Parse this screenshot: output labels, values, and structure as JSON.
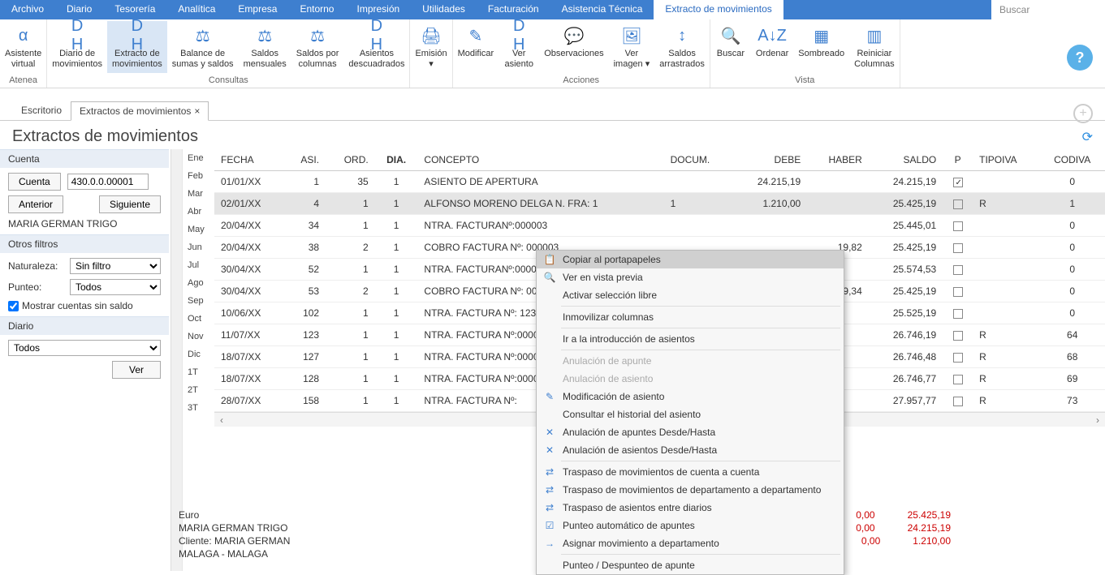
{
  "menubar": {
    "items": [
      "Archivo",
      "Diario",
      "Tesorería",
      "Analítica",
      "Empresa",
      "Entorno",
      "Impresión",
      "Utilidades",
      "Facturación",
      "Asistencia Técnica",
      "Extracto de movimientos"
    ],
    "active_index": 10,
    "search_placeholder": "Buscar"
  },
  "ribbon": {
    "groups": [
      {
        "label": "Atenea",
        "buttons": [
          {
            "label": "Asistente\nvirtual",
            "icon": "α"
          }
        ]
      },
      {
        "label": "Consultas",
        "buttons": [
          {
            "label": "Diario de\nmovimientos",
            "icon": "D H"
          },
          {
            "label": "Extracto de\nmovimientos",
            "icon": "D H",
            "active": true
          },
          {
            "label": "Balance de\nsumas y saldos",
            "icon": "⚖"
          },
          {
            "label": "Saldos\nmensuales",
            "icon": "⚖"
          },
          {
            "label": "Saldos por\ncolumnas",
            "icon": "⚖"
          },
          {
            "label": "Asientos\ndescuadrados",
            "icon": "D H"
          }
        ]
      },
      {
        "label": "",
        "buttons": [
          {
            "label": "Emisión\n▾",
            "icon": "🖨"
          }
        ]
      },
      {
        "label": "Acciones",
        "buttons": [
          {
            "label": "Modificar",
            "icon": "✎"
          },
          {
            "label": "Ver\nasiento",
            "icon": "D H"
          },
          {
            "label": "Observaciones",
            "icon": "💬"
          },
          {
            "label": "Ver\nimagen ▾",
            "icon": "🖼"
          },
          {
            "label": "Saldos\narrastrados",
            "icon": "↕"
          }
        ]
      },
      {
        "label": "Vista",
        "buttons": [
          {
            "label": "Buscar",
            "icon": "🔍"
          },
          {
            "label": "Ordenar",
            "icon": "A↓Z"
          },
          {
            "label": "Sombreado",
            "icon": "▦"
          },
          {
            "label": "Reiniciar\nColumnas",
            "icon": "▥"
          }
        ]
      }
    ]
  },
  "subtabs": {
    "items": [
      {
        "label": "Escritorio",
        "closable": false
      },
      {
        "label": "Extractos de movimientos",
        "closable": true,
        "active": true
      }
    ]
  },
  "page_title": "Extractos de movimientos",
  "sidebar": {
    "sections": {
      "cuenta": {
        "title": "Cuenta",
        "cuenta_btn": "Cuenta",
        "cuenta_val": "430.0.0.00001",
        "anterior": "Anterior",
        "siguiente": "Siguiente",
        "holder_name": "MARIA GERMAN TRIGO"
      },
      "otros": {
        "title": "Otros filtros",
        "naturaleza_label": "Naturaleza:",
        "naturaleza_val": "Sin filtro",
        "punteo_label": "Punteo:",
        "punteo_val": "Todos",
        "mostrar_label": "Mostrar cuentas sin saldo",
        "mostrar_checked": true
      },
      "diario": {
        "title": "Diario",
        "diario_val": "Todos",
        "ver_btn": "Ver"
      }
    }
  },
  "months": [
    "Ene",
    "Feb",
    "Mar",
    "Abr",
    "May",
    "Jun",
    "Jul",
    "Ago",
    "Sep",
    "Oct",
    "Nov",
    "Dic",
    "1T",
    "2T",
    "3T"
  ],
  "table": {
    "headers": [
      "FECHA",
      "ASI.",
      "ORD.",
      "DIA.",
      "CONCEPTO",
      "DOCUM.",
      "DEBE",
      "HABER",
      "SALDO",
      "P",
      "TIPOIVA",
      "CODIVA"
    ],
    "sorted_col": 3,
    "rows": [
      {
        "fecha": "01/01/XX",
        "asi": "1",
        "ord": "35",
        "dia": "1",
        "concepto": "ASIENTO DE APERTURA",
        "docum": "",
        "debe": "24.215,19",
        "haber": "",
        "saldo": "24.215,19",
        "p": true,
        "tipoiva": "",
        "codiva": "0"
      },
      {
        "fecha": "02/01/XX",
        "asi": "4",
        "ord": "1",
        "dia": "1",
        "concepto": "ALFONSO MORENO DELGA N. FRA: 1",
        "docum": "1",
        "debe": "1.210,00",
        "haber": "",
        "saldo": "25.425,19",
        "p": false,
        "tipoiva": "R",
        "codiva": "1",
        "selected": true
      },
      {
        "fecha": "20/04/XX",
        "asi": "34",
        "ord": "1",
        "dia": "1",
        "concepto": "NTRA. FACTURANº:000003",
        "docum": "",
        "debe": "",
        "haber": "",
        "saldo": "25.445,01",
        "p": false,
        "tipoiva": "",
        "codiva": "0"
      },
      {
        "fecha": "20/04/XX",
        "asi": "38",
        "ord": "2",
        "dia": "1",
        "concepto": "COBRO FACTURA Nº: 000003",
        "docum": "",
        "debe": "",
        "haber": "19,82",
        "saldo": "25.425,19",
        "p": false,
        "tipoiva": "",
        "codiva": "0"
      },
      {
        "fecha": "30/04/XX",
        "asi": "52",
        "ord": "1",
        "dia": "1",
        "concepto": "NTRA. FACTURANº:000005",
        "docum": "",
        "debe": "",
        "haber": "",
        "saldo": "25.574,53",
        "p": false,
        "tipoiva": "",
        "codiva": "0"
      },
      {
        "fecha": "30/04/XX",
        "asi": "53",
        "ord": "2",
        "dia": "1",
        "concepto": "COBRO FACTURA Nº: 000005",
        "docum": "",
        "debe": "",
        "haber": "149,34",
        "saldo": "25.425,19",
        "p": false,
        "tipoiva": "",
        "codiva": "0"
      },
      {
        "fecha": "10/06/XX",
        "asi": "102",
        "ord": "1",
        "dia": "1",
        "concepto": "NTRA. FACTURA Nº:  1231",
        "docum": "",
        "debe": "",
        "haber": "",
        "saldo": "25.525,19",
        "p": false,
        "tipoiva": "",
        "codiva": "0"
      },
      {
        "fecha": "11/07/XX",
        "asi": "123",
        "ord": "1",
        "dia": "1",
        "concepto": "NTRA. FACTURA Nº:000001/6",
        "docum": "",
        "debe": "",
        "haber": "",
        "saldo": "26.746,19",
        "p": false,
        "tipoiva": "R",
        "codiva": "64"
      },
      {
        "fecha": "18/07/XX",
        "asi": "127",
        "ord": "1",
        "dia": "1",
        "concepto": "NTRA. FACTURA Nº:000003/1",
        "docum": "",
        "debe": "",
        "haber": "",
        "saldo": "26.746,48",
        "p": false,
        "tipoiva": "R",
        "codiva": "68"
      },
      {
        "fecha": "18/07/XX",
        "asi": "128",
        "ord": "1",
        "dia": "1",
        "concepto": "NTRA. FACTURA Nº:000004/1",
        "docum": "",
        "debe": "",
        "haber": "",
        "saldo": "26.746,77",
        "p": false,
        "tipoiva": "R",
        "codiva": "69"
      },
      {
        "fecha": "28/07/XX",
        "asi": "158",
        "ord": "1",
        "dia": "1",
        "concepto": "NTRA. FACTURA Nº:",
        "docum": "",
        "debe": "",
        "haber": "",
        "saldo": "27.957,77",
        "p": false,
        "tipoiva": "R",
        "codiva": "73"
      }
    ]
  },
  "footer": {
    "currency": "Euro",
    "line1": "MARIA GERMAN TRIGO",
    "line2": "Cliente: MARIA GERMAN",
    "line3": "MALAGA - MALAGA",
    "totals": [
      {
        "a": "0,00",
        "b": "25.425,19"
      },
      {
        "a": "0,00",
        "b": "24.215,19"
      },
      {
        "a": "0,00",
        "b": "1.210,00"
      }
    ]
  },
  "contextmenu": {
    "items": [
      {
        "label": "Copiar al portapapeles",
        "icon": "📋",
        "hover": true
      },
      {
        "label": "Ver en vista previa",
        "icon": "🔍"
      },
      {
        "label": "Activar selección libre"
      },
      {
        "sep": true
      },
      {
        "label": "Inmovilizar columnas"
      },
      {
        "sep": true
      },
      {
        "label": "Ir a la introducción de asientos"
      },
      {
        "sep": true
      },
      {
        "label": "Anulación de apunte",
        "disabled": true
      },
      {
        "label": "Anulación de asiento",
        "disabled": true
      },
      {
        "label": "Modificación de asiento",
        "icon": "✎"
      },
      {
        "label": "Consultar el historial del asiento"
      },
      {
        "label": "Anulación de apuntes Desde/Hasta",
        "icon": "✕"
      },
      {
        "label": "Anulación de asientos Desde/Hasta",
        "icon": "✕"
      },
      {
        "sep": true
      },
      {
        "label": "Traspaso de movimientos de cuenta a cuenta",
        "icon": "⇄"
      },
      {
        "label": "Traspaso de movimientos de departamento a departamento",
        "icon": "⇄"
      },
      {
        "label": "Traspaso de asientos entre diarios",
        "icon": "⇄"
      },
      {
        "label": "Punteo automático de apuntes",
        "icon": "☑"
      },
      {
        "label": "Asignar movimiento a departamento",
        "icon": "→"
      },
      {
        "sep": true
      },
      {
        "label": "Punteo / Despunteo de apunte"
      }
    ]
  }
}
